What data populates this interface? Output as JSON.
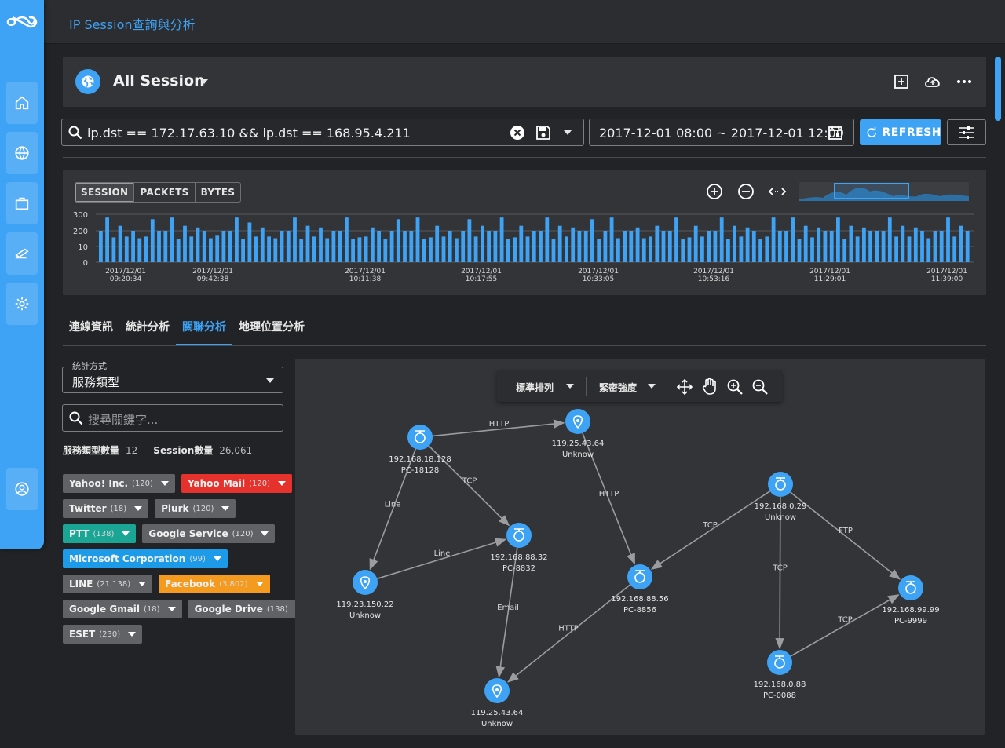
{
  "app": {
    "title": "IP Session查詢與分析"
  },
  "colors": {
    "accent": "#3ea2f5",
    "red": "#e5322d",
    "teal": "#1aa595",
    "blue": "#1e9be8",
    "orange": "#f49a1e",
    "grey": "#606266"
  },
  "sidebar": {
    "items": [
      "home-icon",
      "globe-icon",
      "briefcase-icon",
      "device-icon",
      "gear-icon",
      "user-icon"
    ]
  },
  "header": {
    "title": "All Session",
    "actions": [
      "add-box-icon",
      "cloud-upload-icon",
      "more-icon"
    ]
  },
  "search": {
    "query": "ip.dst == 172.17.63.10 && ip.dst == 168.95.4.211"
  },
  "date_range": {
    "value": "2017-12-01 08:00 ~ 2017-12-01 12:00"
  },
  "refresh_label": "REFRESH",
  "chart_toggle": {
    "session": "SESSION",
    "packets": "PACKETS",
    "bytes": "BYTES",
    "active": "SESSION"
  },
  "chart_data": {
    "type": "bar",
    "y_ticks": [
      "300",
      "200",
      "10",
      "0"
    ],
    "x_ticks": [
      [
        "2017/12/01",
        "09:20:34"
      ],
      [
        "2017/12/01",
        "09:42:38"
      ],
      [
        "2017/12/01",
        "10:11:38"
      ],
      [
        "2017/12/01",
        "10:17:55"
      ],
      [
        "2017/12/01",
        "10:33:05"
      ],
      [
        "2017/12/01",
        "10:53:16"
      ],
      [
        "2017/12/01",
        "11:29:01"
      ],
      [
        "2017/12/01",
        "11:39:00"
      ]
    ],
    "values": [
      200,
      280,
      120,
      230,
      130,
      200,
      110,
      130,
      270,
      200,
      200,
      280,
      100,
      230,
      130,
      220,
      200,
      110,
      140,
      200,
      200,
      280,
      100,
      250,
      130,
      220,
      130,
      110,
      200,
      200,
      280,
      100,
      230,
      130,
      220,
      110,
      200,
      200,
      280,
      100,
      120,
      130,
      220,
      200,
      100,
      200,
      270,
      200,
      200,
      280,
      100,
      120,
      230,
      130,
      200,
      110,
      200,
      270,
      130,
      230,
      200,
      200,
      280,
      100,
      120,
      230,
      130,
      200,
      200,
      280,
      100,
      230,
      130,
      220,
      200,
      200,
      270,
      100,
      200,
      280,
      110,
      200,
      200,
      220,
      110,
      130,
      230,
      200,
      200,
      280,
      100,
      120,
      230,
      130,
      200,
      200,
      280,
      100,
      230,
      130,
      220,
      200,
      100,
      130,
      280,
      200,
      200,
      280,
      100,
      230,
      120,
      220,
      200,
      200,
      280,
      100,
      230,
      130,
      220,
      200,
      200,
      200,
      280,
      130,
      230,
      130,
      220,
      200,
      110,
      200,
      200,
      280,
      130,
      230,
      200
    ]
  },
  "tabs": [
    "連線資訊",
    "統計分析",
    "關聯分析",
    "地理位置分析"
  ],
  "active_tab": "關聯分析",
  "left_panel": {
    "stat_mode_label": "統計方式",
    "stat_mode_value": "服務類型",
    "keyword_placeholder": "搜尋關鍵字...",
    "service_count_label": "服務類型數量",
    "service_count": "12",
    "session_count_label": "Session數量",
    "session_count": "26,061"
  },
  "chips": [
    [
      {
        "name": "Yahoo! Inc.",
        "count": "(120)",
        "color": "grey"
      },
      {
        "name": "Yahoo Mail",
        "count": "(120)",
        "color": "red"
      }
    ],
    [
      {
        "name": "Twitter",
        "count": "(18)",
        "color": "grey"
      },
      {
        "name": "Plurk",
        "count": "(120)",
        "color": "grey"
      }
    ],
    [
      {
        "name": "PTT",
        "count": "(138)",
        "color": "teal"
      },
      {
        "name": "Google Service",
        "count": "(120)",
        "color": "grey"
      }
    ],
    [
      {
        "name": "Microsoft Corporation",
        "count": "(99)",
        "color": "blue"
      }
    ],
    [
      {
        "name": "LINE",
        "count": "(21,138)",
        "color": "grey"
      },
      {
        "name": "Facebook",
        "count": "(3,802)",
        "color": "orange"
      }
    ],
    [
      {
        "name": "Google Gmail",
        "count": "(18)",
        "color": "grey"
      },
      {
        "name": "Google Drive",
        "count": "(138)",
        "color": "grey"
      }
    ],
    [
      {
        "name": "ESET",
        "count": "(230)",
        "color": "grey"
      }
    ]
  ],
  "graph": {
    "toolbar": {
      "layout": "標準排列",
      "density": "緊密強度"
    },
    "nodes": [
      {
        "id": "n1",
        "ip": "192.168.18.128",
        "name": "PC-18128",
        "type": "pc"
      },
      {
        "id": "n2",
        "ip": "119.25.43.64",
        "name": "Unknow",
        "type": "loc"
      },
      {
        "id": "n3",
        "ip": "192.168.88.32",
        "name": "PC-8832",
        "type": "pc"
      },
      {
        "id": "n4",
        "ip": "119.23.150.22",
        "name": "Unknow",
        "type": "loc"
      },
      {
        "id": "n5",
        "ip": "192.168.88.56",
        "name": "PC-8856",
        "type": "pc"
      },
      {
        "id": "n6",
        "ip": "119.25.43.64",
        "name": "Unknow",
        "type": "loc"
      },
      {
        "id": "n7",
        "ip": "192.168.0.29",
        "name": "Unknow",
        "type": "pc"
      },
      {
        "id": "n8",
        "ip": "192.168.99.99",
        "name": "PC-9999",
        "type": "pc"
      },
      {
        "id": "n9",
        "ip": "192.168.0.88",
        "name": "PC-0088",
        "type": "pc"
      }
    ],
    "edges": [
      {
        "from": "n1",
        "to": "n2",
        "label": "HTTP"
      },
      {
        "from": "n1",
        "to": "n3",
        "label": "TCP"
      },
      {
        "from": "n1",
        "to": "n4",
        "label": "Line"
      },
      {
        "from": "n4",
        "to": "n3",
        "label": "Line"
      },
      {
        "from": "n3",
        "to": "n6",
        "label": "Email"
      },
      {
        "from": "n2",
        "to": "n5",
        "label": "HTTP"
      },
      {
        "from": "n5",
        "to": "n6",
        "label": "HTTP"
      },
      {
        "from": "n7",
        "to": "n5",
        "label": "TCP"
      },
      {
        "from": "n7",
        "to": "n8",
        "label": "FTP"
      },
      {
        "from": "n7",
        "to": "n9",
        "label": "TCP"
      },
      {
        "from": "n9",
        "to": "n8",
        "label": "TCP"
      }
    ]
  }
}
